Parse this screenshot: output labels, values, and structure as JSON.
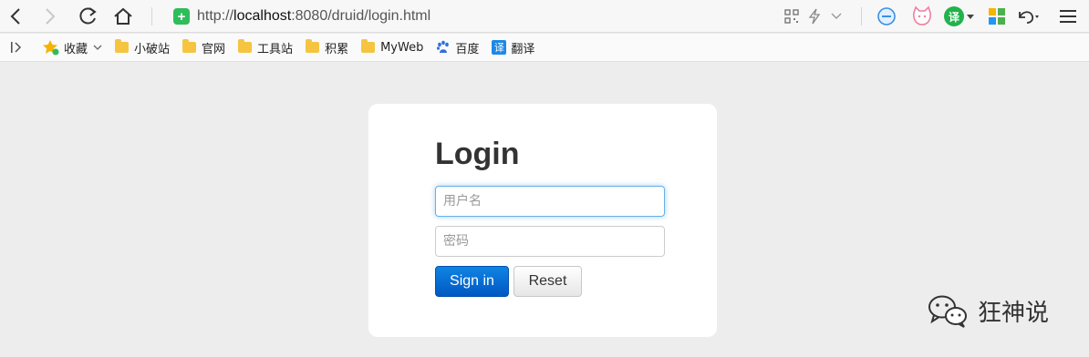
{
  "browser": {
    "url_prefix": "http://",
    "url_host": "localhost",
    "url_rest": ":8080/druid/login.html",
    "translate_badge": "译"
  },
  "bookmarks": {
    "items": [
      {
        "label": "收藏",
        "icon": "star-icon"
      },
      {
        "label": "小破站",
        "icon": "folder-icon"
      },
      {
        "label": "官网",
        "icon": "folder-icon"
      },
      {
        "label": "工具站",
        "icon": "folder-icon"
      },
      {
        "label": "积累",
        "icon": "folder-icon"
      },
      {
        "label": "MyWeb",
        "icon": "folder-icon"
      },
      {
        "label": "百度",
        "icon": "baidu-paw-icon"
      },
      {
        "label": "翻译",
        "icon": "translate-icon",
        "badge": "译"
      }
    ]
  },
  "login": {
    "title": "Login",
    "username_placeholder": "用户名",
    "password_placeholder": "密码",
    "sign_in_label": "Sign in",
    "reset_label": "Reset"
  },
  "watermark": {
    "text": "狂神说"
  },
  "colors": {
    "page_bg": "#ededed",
    "primary": "#0f84e3",
    "shield_green": "#2ebd59"
  }
}
